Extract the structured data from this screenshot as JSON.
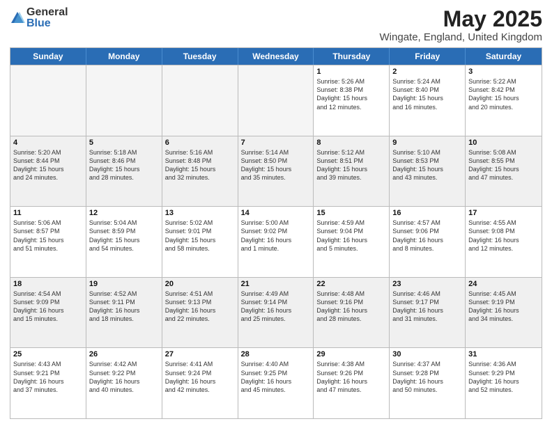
{
  "logo": {
    "general": "General",
    "blue": "Blue"
  },
  "title": {
    "month": "May 2025",
    "location": "Wingate, England, United Kingdom"
  },
  "weekdays": [
    "Sunday",
    "Monday",
    "Tuesday",
    "Wednesday",
    "Thursday",
    "Friday",
    "Saturday"
  ],
  "rows": [
    [
      {
        "day": "",
        "info": "",
        "empty": true
      },
      {
        "day": "",
        "info": "",
        "empty": true
      },
      {
        "day": "",
        "info": "",
        "empty": true
      },
      {
        "day": "",
        "info": "",
        "empty": true
      },
      {
        "day": "1",
        "info": "Sunrise: 5:26 AM\nSunset: 8:38 PM\nDaylight: 15 hours\nand 12 minutes."
      },
      {
        "day": "2",
        "info": "Sunrise: 5:24 AM\nSunset: 8:40 PM\nDaylight: 15 hours\nand 16 minutes."
      },
      {
        "day": "3",
        "info": "Sunrise: 5:22 AM\nSunset: 8:42 PM\nDaylight: 15 hours\nand 20 minutes."
      }
    ],
    [
      {
        "day": "4",
        "info": "Sunrise: 5:20 AM\nSunset: 8:44 PM\nDaylight: 15 hours\nand 24 minutes."
      },
      {
        "day": "5",
        "info": "Sunrise: 5:18 AM\nSunset: 8:46 PM\nDaylight: 15 hours\nand 28 minutes."
      },
      {
        "day": "6",
        "info": "Sunrise: 5:16 AM\nSunset: 8:48 PM\nDaylight: 15 hours\nand 32 minutes."
      },
      {
        "day": "7",
        "info": "Sunrise: 5:14 AM\nSunset: 8:50 PM\nDaylight: 15 hours\nand 35 minutes."
      },
      {
        "day": "8",
        "info": "Sunrise: 5:12 AM\nSunset: 8:51 PM\nDaylight: 15 hours\nand 39 minutes."
      },
      {
        "day": "9",
        "info": "Sunrise: 5:10 AM\nSunset: 8:53 PM\nDaylight: 15 hours\nand 43 minutes."
      },
      {
        "day": "10",
        "info": "Sunrise: 5:08 AM\nSunset: 8:55 PM\nDaylight: 15 hours\nand 47 minutes."
      }
    ],
    [
      {
        "day": "11",
        "info": "Sunrise: 5:06 AM\nSunset: 8:57 PM\nDaylight: 15 hours\nand 51 minutes."
      },
      {
        "day": "12",
        "info": "Sunrise: 5:04 AM\nSunset: 8:59 PM\nDaylight: 15 hours\nand 54 minutes."
      },
      {
        "day": "13",
        "info": "Sunrise: 5:02 AM\nSunset: 9:01 PM\nDaylight: 15 hours\nand 58 minutes."
      },
      {
        "day": "14",
        "info": "Sunrise: 5:00 AM\nSunset: 9:02 PM\nDaylight: 16 hours\nand 1 minute."
      },
      {
        "day": "15",
        "info": "Sunrise: 4:59 AM\nSunset: 9:04 PM\nDaylight: 16 hours\nand 5 minutes."
      },
      {
        "day": "16",
        "info": "Sunrise: 4:57 AM\nSunset: 9:06 PM\nDaylight: 16 hours\nand 8 minutes."
      },
      {
        "day": "17",
        "info": "Sunrise: 4:55 AM\nSunset: 9:08 PM\nDaylight: 16 hours\nand 12 minutes."
      }
    ],
    [
      {
        "day": "18",
        "info": "Sunrise: 4:54 AM\nSunset: 9:09 PM\nDaylight: 16 hours\nand 15 minutes."
      },
      {
        "day": "19",
        "info": "Sunrise: 4:52 AM\nSunset: 9:11 PM\nDaylight: 16 hours\nand 18 minutes."
      },
      {
        "day": "20",
        "info": "Sunrise: 4:51 AM\nSunset: 9:13 PM\nDaylight: 16 hours\nand 22 minutes."
      },
      {
        "day": "21",
        "info": "Sunrise: 4:49 AM\nSunset: 9:14 PM\nDaylight: 16 hours\nand 25 minutes."
      },
      {
        "day": "22",
        "info": "Sunrise: 4:48 AM\nSunset: 9:16 PM\nDaylight: 16 hours\nand 28 minutes."
      },
      {
        "day": "23",
        "info": "Sunrise: 4:46 AM\nSunset: 9:17 PM\nDaylight: 16 hours\nand 31 minutes."
      },
      {
        "day": "24",
        "info": "Sunrise: 4:45 AM\nSunset: 9:19 PM\nDaylight: 16 hours\nand 34 minutes."
      }
    ],
    [
      {
        "day": "25",
        "info": "Sunrise: 4:43 AM\nSunset: 9:21 PM\nDaylight: 16 hours\nand 37 minutes."
      },
      {
        "day": "26",
        "info": "Sunrise: 4:42 AM\nSunset: 9:22 PM\nDaylight: 16 hours\nand 40 minutes."
      },
      {
        "day": "27",
        "info": "Sunrise: 4:41 AM\nSunset: 9:24 PM\nDaylight: 16 hours\nand 42 minutes."
      },
      {
        "day": "28",
        "info": "Sunrise: 4:40 AM\nSunset: 9:25 PM\nDaylight: 16 hours\nand 45 minutes."
      },
      {
        "day": "29",
        "info": "Sunrise: 4:38 AM\nSunset: 9:26 PM\nDaylight: 16 hours\nand 47 minutes."
      },
      {
        "day": "30",
        "info": "Sunrise: 4:37 AM\nSunset: 9:28 PM\nDaylight: 16 hours\nand 50 minutes."
      },
      {
        "day": "31",
        "info": "Sunrise: 4:36 AM\nSunset: 9:29 PM\nDaylight: 16 hours\nand 52 minutes."
      }
    ]
  ]
}
